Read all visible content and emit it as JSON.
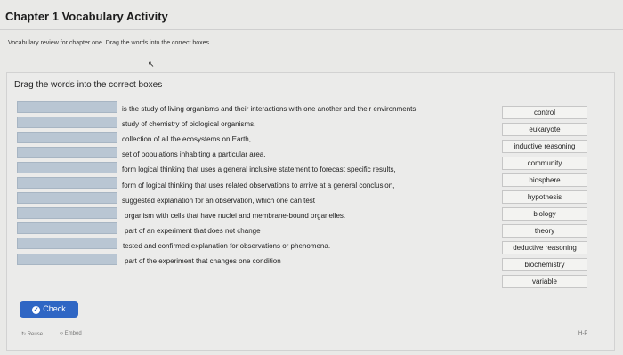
{
  "header": {
    "title": "Chapter 1 Vocabulary Activity",
    "description": "Vocabulary review for chapter one. Drag the words into the correct boxes."
  },
  "activity": {
    "instruction": "Drag the words into the correct boxes",
    "definitions": [
      "is the study of living organisms and their interactions with one another and their environments,",
      "study of chemistry of biological organisms,",
      "collection of all the ecosystems on Earth,",
      "set of populations inhabiting a particular area,",
      "form logical thinking that uses a general inclusive statement to forecast specific results,",
      "form of logical thinking that uses related observations to arrive at a general conclusion,",
      "suggested explanation for an observation, which one can test",
      "organism with cells that have nuclei and membrane-bound organelles.",
      "part of an experiment that does not change",
      "tested and confirmed explanation for observations or phenomena.",
      "part of the experiment that changes one condition"
    ],
    "words": [
      "control",
      "eukaryote",
      "inductive reasoning",
      "community",
      "biosphere",
      "hypothesis",
      "biology",
      "theory",
      "deductive reasoning",
      "biochemistry",
      "variable"
    ]
  },
  "actions": {
    "check_label": "Check",
    "reuse_label": "Reuse",
    "embed_label": "Embed",
    "help_label": "H-P"
  },
  "colors": {
    "check_button": "#2f66c4",
    "dropzone": "#b9c6d3"
  }
}
